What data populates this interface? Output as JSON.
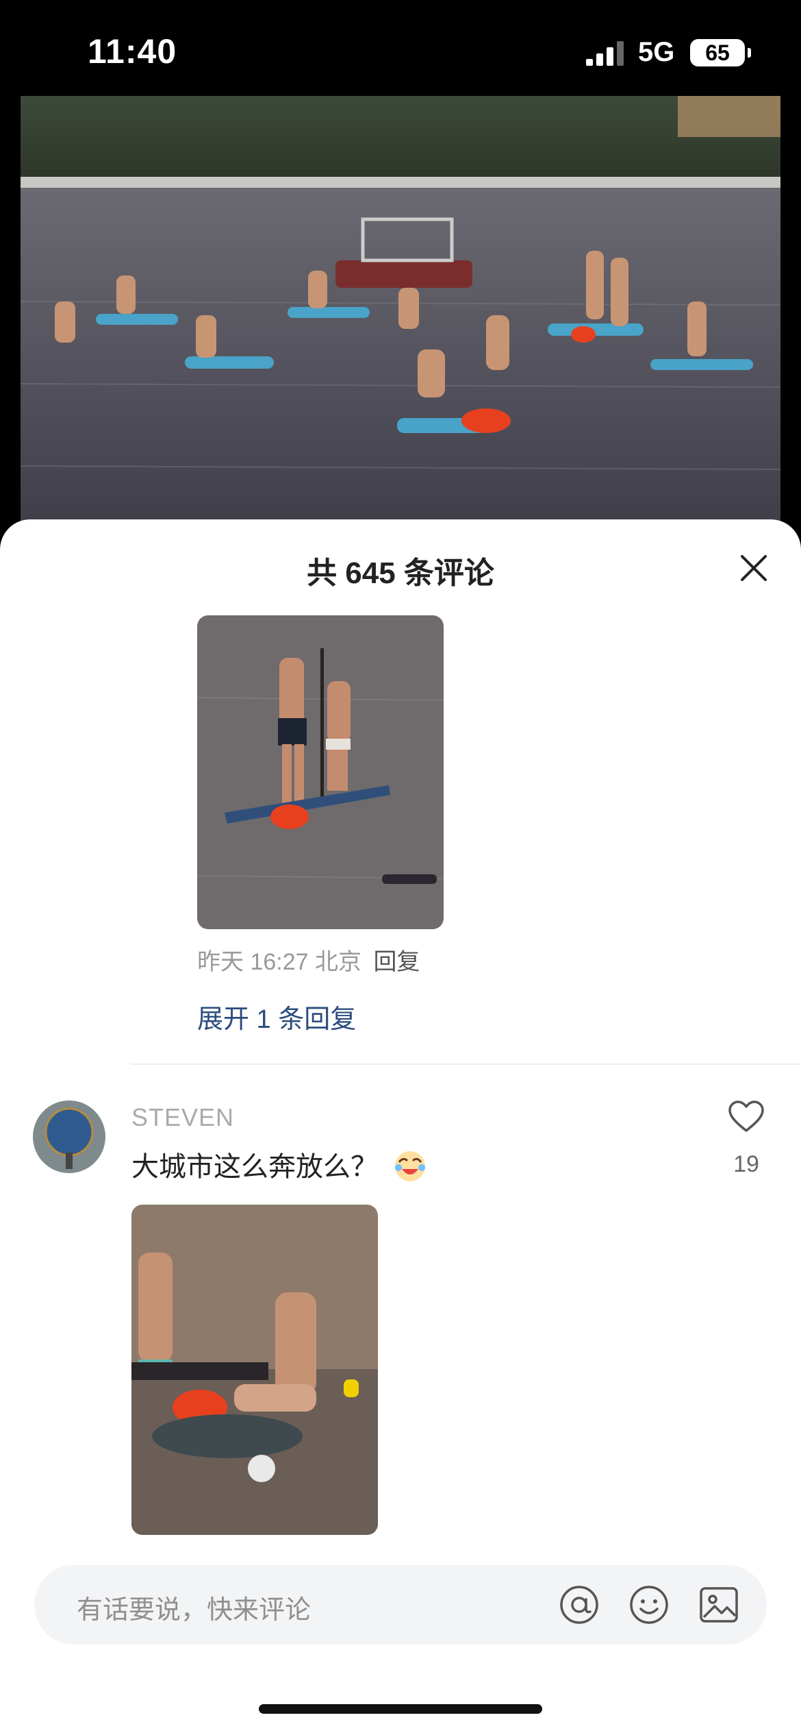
{
  "status_bar": {
    "time": "11:40",
    "network": "5G",
    "battery": "65"
  },
  "comments_panel": {
    "title": "共 645 条评论",
    "close_icon": "close-icon"
  },
  "previous_comment": {
    "time": "昨天 16:27",
    "location": "北京",
    "reply_label": "回复",
    "expand_label": "展开 1 条回复"
  },
  "comment": {
    "username": "STEVEN",
    "text": "大城市这么奔放么？",
    "emoji": "crying-laugh-emoji",
    "like_count": "19"
  },
  "input": {
    "placeholder": "有话要说，快来评论",
    "icons": [
      "at-icon",
      "emoji-icon",
      "image-icon"
    ]
  }
}
